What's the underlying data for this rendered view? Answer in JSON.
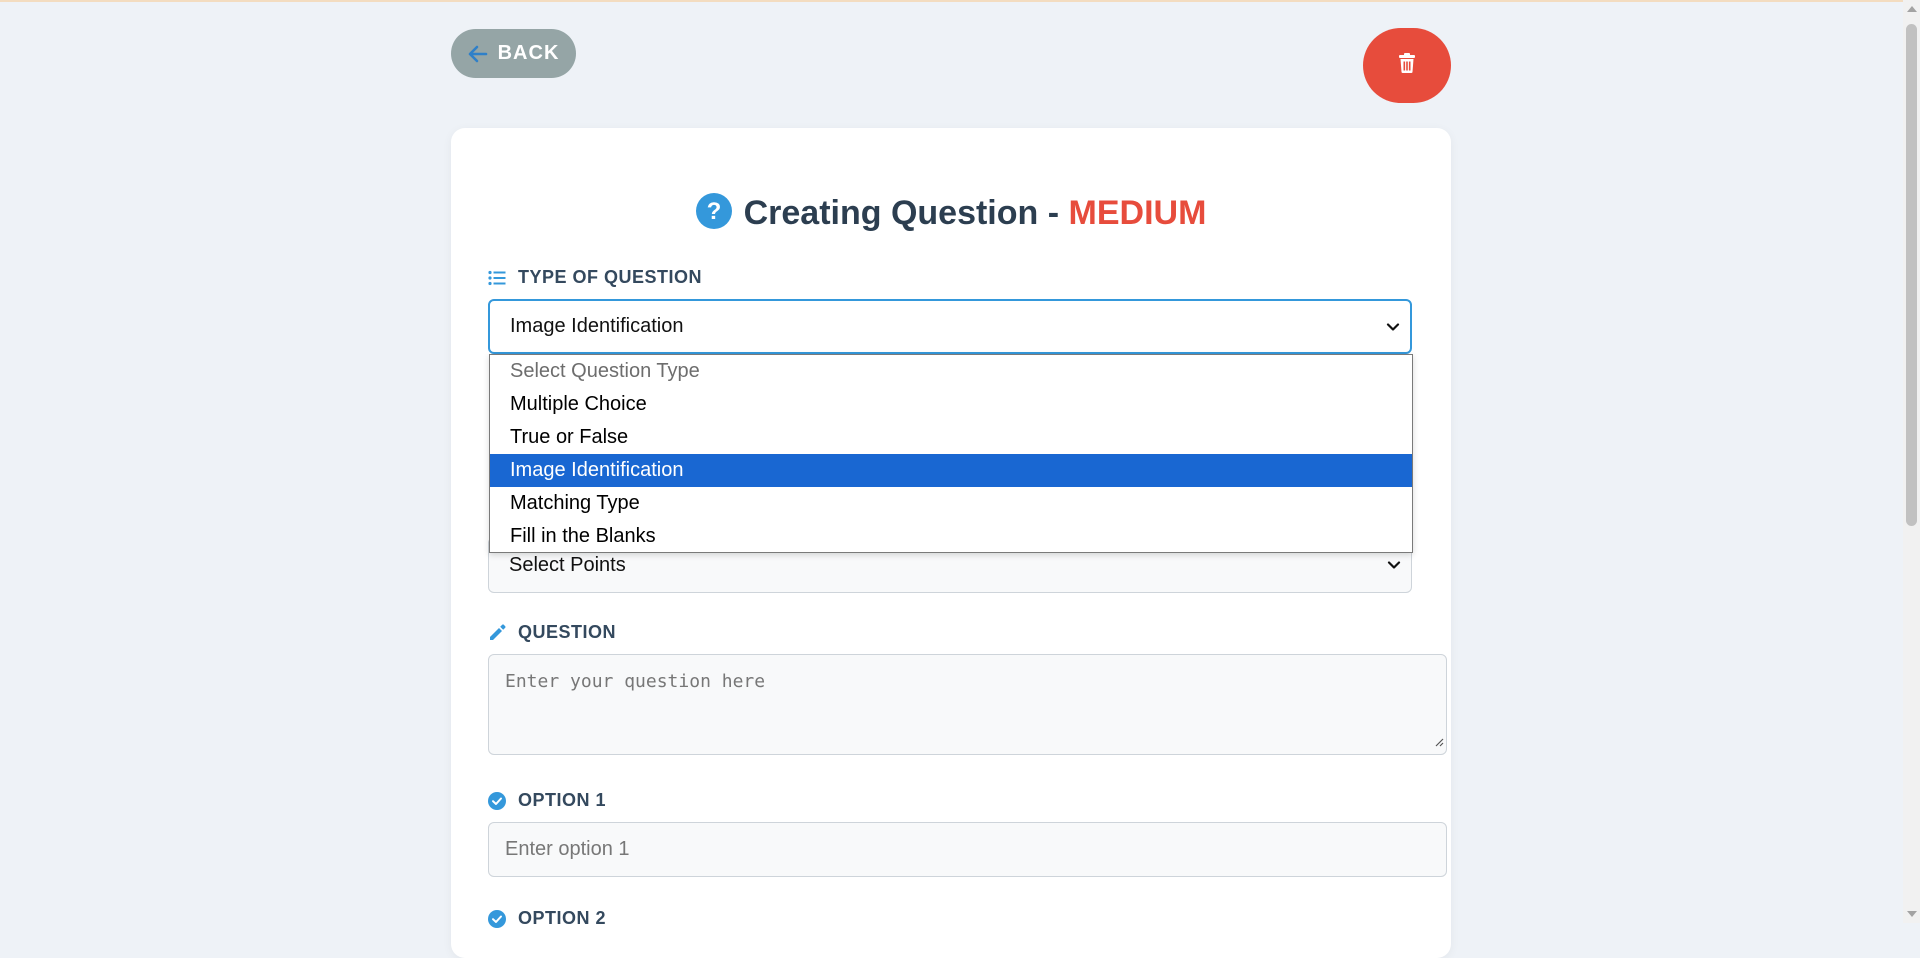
{
  "header": {
    "back_label": "BACK",
    "back_icon": "arrow-left-icon",
    "delete_icon": "trash-icon"
  },
  "card": {
    "title_prefix": "Creating Question - ",
    "title_level": "MEDIUM",
    "title_icon": "question-circle-icon"
  },
  "type_field": {
    "label": "TYPE OF QUESTION",
    "icon": "list-icon",
    "value": "Image Identification",
    "options": [
      "Select Question Type",
      "Multiple Choice",
      "True or False",
      "Image Identification",
      "Matching Type",
      "Fill in the Blanks"
    ],
    "selected_index": 3
  },
  "points_field": {
    "value": "Select Points"
  },
  "question_field": {
    "label": "QUESTION",
    "icon": "pencil-icon",
    "placeholder": "Enter your question here"
  },
  "option1_field": {
    "label": "OPTION 1",
    "icon": "check-circle-icon",
    "placeholder": "Enter option 1"
  },
  "option2_field": {
    "label": "OPTION 2",
    "icon": "check-circle-icon"
  },
  "colors": {
    "accent": "#3498db",
    "danger": "#e74c3c",
    "back_button": "#95a5a6",
    "selected_option": "#1967d2"
  }
}
